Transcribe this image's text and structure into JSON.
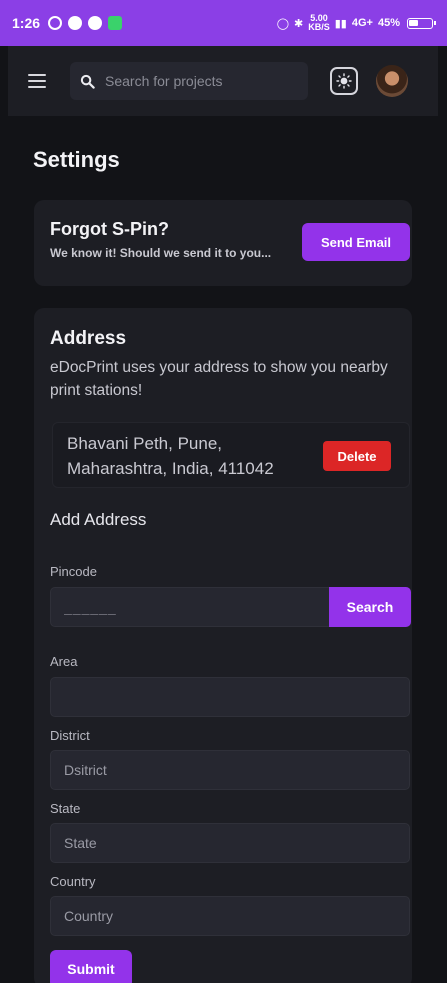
{
  "status_bar": {
    "time": "1:26",
    "speed_value": "5.00",
    "speed_unit": "KB/S",
    "battery": "45%",
    "net": "4G+",
    "colors": {
      "background": "#8b3fe6"
    }
  },
  "header": {
    "search_placeholder": "Search for projects",
    "icons": [
      "menu-icon",
      "search-icon",
      "theme-toggle-icon",
      "avatar"
    ]
  },
  "page": {
    "title": "Settings"
  },
  "forgot_spin": {
    "heading": "Forgot S-Pin?",
    "subtitle": "We know it! Should we send it to you...",
    "button_label": "Send Email"
  },
  "address": {
    "heading": "Address",
    "description": "eDocPrint uses your address to show you nearby print stations!",
    "saved_address": "Bhavani Peth, Pune, Maharashtra, India, 411042",
    "delete_label": "Delete",
    "add_heading": "Add Address",
    "pincode_label": "Pincode",
    "pincode_placeholder": "______",
    "search_label": "Search",
    "area_label": "Area",
    "area_value": "",
    "district_label": "District",
    "district_placeholder": "Dsitrict",
    "state_label": "State",
    "state_placeholder": "State",
    "country_label": "Country",
    "country_placeholder": "Country",
    "submit_label": "Submit"
  },
  "colors": {
    "accent": "#9333ea",
    "danger": "#dc2626",
    "card": "#1d1e24",
    "background": "#121317"
  }
}
